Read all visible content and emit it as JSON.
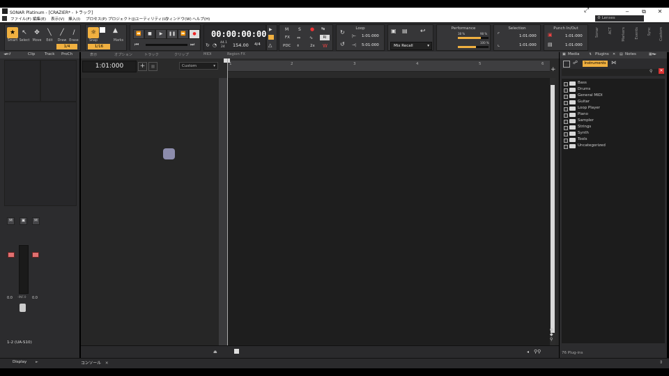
{
  "window": {
    "title": "SONAR Platinum - [CRAZIER* - トラック]",
    "min": "‒",
    "max": "⧉",
    "close": "✕",
    "view_icon": "⤢"
  },
  "menu": [
    "ファイル(F)",
    "編集(E)",
    "表示(V)",
    "挿入(I)",
    "プロセス(P)",
    "プロジェクト(J)",
    "ユーティリティ(U)",
    "ウィンドウ(W)",
    "ヘルプ(H)"
  ],
  "lenses": {
    "label": "Lenses"
  },
  "tools": [
    {
      "label": "Smart",
      "icon": "★"
    },
    {
      "label": "Select",
      "icon": "↖"
    },
    {
      "label": "Move",
      "icon": "✥"
    },
    {
      "label": "Edit",
      "icon": "╲"
    },
    {
      "label": "Draw",
      "icon": "╱"
    },
    {
      "label": "Erase",
      "icon": "∕"
    }
  ],
  "tool_fraction": "1/4",
  "snap": {
    "label": "Snap",
    "value": "1/16",
    "marks": "Marks"
  },
  "transport": {
    "time": "00:00:00:00",
    "sample_rate": "44.1",
    "bit_depth": "24",
    "tempo": "154.00",
    "meter": "4/4"
  },
  "mix_buttons": [
    "M",
    "S",
    "●",
    "FX",
    "PDC",
    "2x"
  ],
  "loop": {
    "header": "Loop",
    "start": "1:01:000",
    "end": "5:01:000"
  },
  "mix_recall": {
    "label": "Mix Recall"
  },
  "performance": {
    "header": "Performance",
    "cpu_pct": "38 %",
    "cpu_pct2": "98 %",
    "disk_pct": "100 %",
    "cpu_level": 0.75,
    "disk_level": 0.6
  },
  "selection": {
    "header": "Selection",
    "start": "1:01:000",
    "end": "1:01:000"
  },
  "punch": {
    "header": "Punch In/Out",
    "start": "1:01:000",
    "end": "1:01:000"
  },
  "side_tabs": [
    "Sonar",
    "ACT",
    "Markers",
    "Events",
    "Sync",
    "Custom"
  ],
  "left_tabs": [
    "Clip",
    "Track",
    "ProCh"
  ],
  "track_menu": [
    "表示",
    "オプション",
    "トラック",
    "クリップ",
    "MIDI",
    "Region FX"
  ],
  "timecode": "1:01:000",
  "custom_select": "Custom",
  "ruler_ticks": [
    "1",
    "2",
    "3",
    "4",
    "5",
    "6"
  ],
  "right_tabs": [
    "Media",
    "Plugins",
    "Notes"
  ],
  "instruments_btn": "Instruments",
  "plugin_tree": [
    "Bass",
    "Drums",
    "General MIDI",
    "Guitar",
    "Loop Player",
    "Piano",
    "Sampler",
    "Strings",
    "Synth",
    "Tools",
    "Uncategorized"
  ],
  "plugin_count": "76 Plug-ins",
  "channel": {
    "name": "1-2 (UA-S10)",
    "vol_left": "0.0",
    "vol_mid": "-INF.0",
    "vol_right": "0.0",
    "m": "M"
  },
  "console_tab": "コンソール",
  "display_tab": "Display"
}
